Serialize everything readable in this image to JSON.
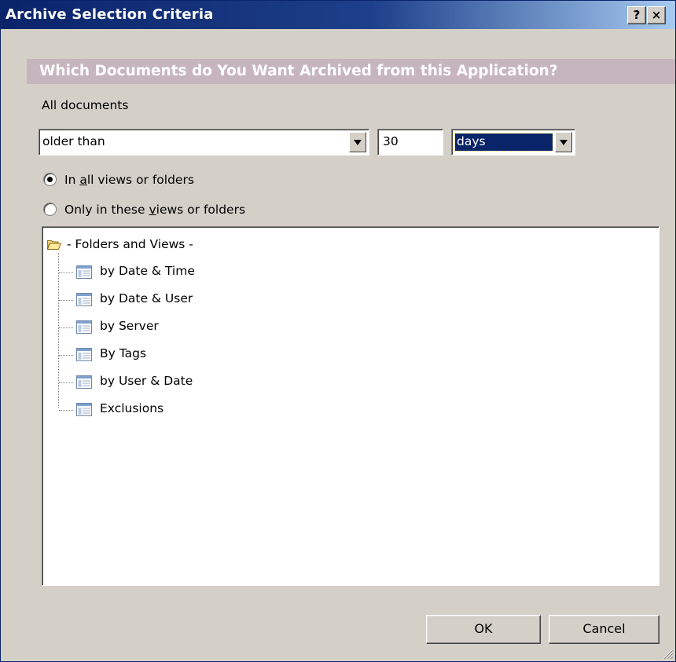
{
  "window": {
    "title": "Archive Selection Criteria",
    "help_glyph": "?",
    "close_glyph": "×"
  },
  "header": {
    "question": "Which Documents do You Want Archived from this Application?"
  },
  "criteria": {
    "scope_label": "All documents",
    "age_operator": "older than",
    "age_value": "30",
    "age_unit": "days"
  },
  "location": {
    "all_label_pre": "In ",
    "all_label_key": "a",
    "all_label_post": "ll views or folders",
    "all_selected": true,
    "only_label_pre": "Only in these ",
    "only_label_key": "v",
    "only_label_post": "iews or folders",
    "only_selected": false
  },
  "tree": {
    "root_label": "- Folders and Views -",
    "root_icon": "folder-open-icon",
    "item_icon": "view-icon",
    "items": [
      {
        "label": "by Date & Time"
      },
      {
        "label": "by Date & User"
      },
      {
        "label": "by Server"
      },
      {
        "label": "By Tags"
      },
      {
        "label": "by User & Date"
      },
      {
        "label": "Exclusions"
      }
    ]
  },
  "buttons": {
    "ok": "OK",
    "cancel": "Cancel"
  },
  "colors": {
    "title_bar": "#0a246a",
    "dialog_face": "#d4d0c8",
    "header_band": "#c7b5bd",
    "selection": "#0a246a"
  }
}
